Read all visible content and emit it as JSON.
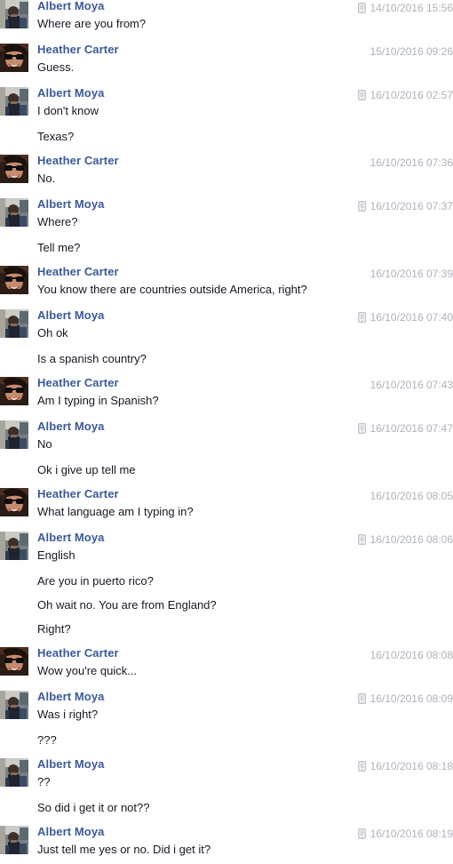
{
  "conversation": {
    "participants": {
      "albert": "Albert Moya",
      "heather": "Heather Carter"
    },
    "messages": [
      {
        "sender": "Albert Moya",
        "avatar": "albert",
        "mobile": true,
        "time": "14/10/2016 15:56",
        "lines": [
          "Where are you from?"
        ]
      },
      {
        "sender": "Heather Carter",
        "avatar": "heather",
        "mobile": false,
        "time": "15/10/2016 09:26",
        "lines": [
          "Guess."
        ]
      },
      {
        "sender": "Albert Moya",
        "avatar": "albert",
        "mobile": true,
        "time": "16/10/2016 02:57",
        "lines": [
          "I don't know",
          "Texas?"
        ]
      },
      {
        "sender": "Heather Carter",
        "avatar": "heather",
        "mobile": false,
        "time": "16/10/2016 07:36",
        "lines": [
          "No."
        ]
      },
      {
        "sender": "Albert Moya",
        "avatar": "albert",
        "mobile": true,
        "time": "16/10/2016 07:37",
        "lines": [
          "Where?",
          "Tell me?"
        ]
      },
      {
        "sender": "Heather Carter",
        "avatar": "heather",
        "mobile": false,
        "time": "16/10/2016 07:39",
        "lines": [
          "You know there are countries outside America, right?"
        ]
      },
      {
        "sender": "Albert Moya",
        "avatar": "albert",
        "mobile": true,
        "time": "16/10/2016 07:40",
        "lines": [
          "Oh ok",
          "Is a spanish country?"
        ]
      },
      {
        "sender": "Heather Carter",
        "avatar": "heather",
        "mobile": false,
        "time": "16/10/2016 07:43",
        "lines": [
          "Am I typing in Spanish?"
        ]
      },
      {
        "sender": "Albert Moya",
        "avatar": "albert",
        "mobile": true,
        "time": "16/10/2016 07:47",
        "lines": [
          "No",
          "Ok i give up tell me"
        ]
      },
      {
        "sender": "Heather Carter",
        "avatar": "heather",
        "mobile": false,
        "time": "16/10/2016 08:05",
        "lines": [
          "What language am I typing in?"
        ]
      },
      {
        "sender": "Albert Moya",
        "avatar": "albert",
        "mobile": true,
        "time": "16/10/2016 08:06",
        "lines": [
          "English",
          "Are you in puerto rico?",
          "Oh wait no. You are from England?",
          "Right?"
        ]
      },
      {
        "sender": "Heather Carter",
        "avatar": "heather",
        "mobile": false,
        "time": "16/10/2016 08:08",
        "lines": [
          "Wow you're quick..."
        ]
      },
      {
        "sender": "Albert Moya",
        "avatar": "albert",
        "mobile": true,
        "time": "16/10/2016 08:09",
        "lines": [
          "Was i right?",
          "???"
        ]
      },
      {
        "sender": "Albert Moya",
        "avatar": "albert",
        "mobile": true,
        "time": "16/10/2016 08:18",
        "lines": [
          "??",
          "So did i get it or not??"
        ]
      },
      {
        "sender": "Albert Moya",
        "avatar": "albert",
        "mobile": true,
        "time": "16/10/2016 08:19",
        "lines": [
          "Just tell me yes or no. Did i get it?"
        ]
      }
    ]
  },
  "icons": {
    "mobile": "mobile-phone-icon"
  },
  "colors": {
    "sender_name": "#3b5998",
    "message_text": "#141823",
    "timestamp": "#adb2bb"
  }
}
